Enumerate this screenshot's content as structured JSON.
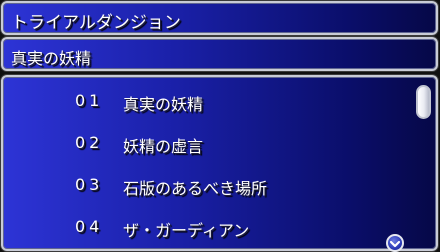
{
  "window": {
    "title": "トライアルダンジョン"
  },
  "header": {
    "subtitle": "真実の妖精"
  },
  "list": {
    "items": [
      {
        "number": "01",
        "name": "真実の妖精"
      },
      {
        "number": "02",
        "name": "妖精の虚言"
      },
      {
        "number": "03",
        "name": "石版のあるべき場所"
      },
      {
        "number": "04",
        "name": "ザ・ガーディアン"
      }
    ]
  },
  "colors": {
    "panel_light": "#2d34d6",
    "panel_dark": "#060847",
    "border": "#c9ccd6",
    "text": "#ffffff"
  },
  "icons": {
    "scroll_down": "chevron-down-icon"
  }
}
